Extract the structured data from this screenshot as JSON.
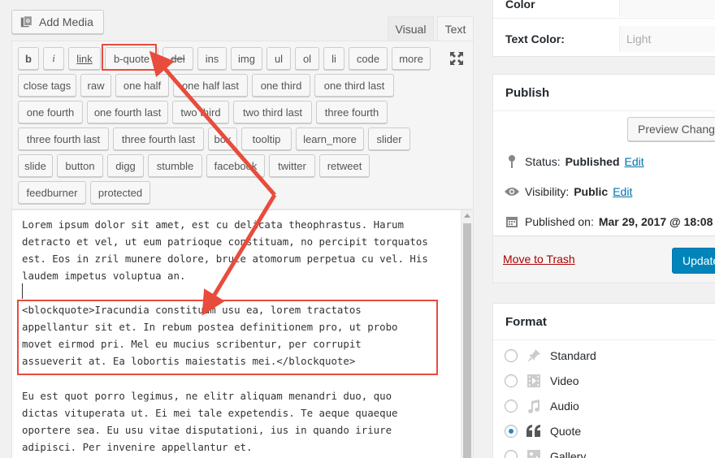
{
  "editor": {
    "add_media_label": "Add Media",
    "tabs": {
      "visual": "Visual",
      "text": "Text"
    },
    "quicktags": [
      [
        "b",
        "i",
        "link",
        "b-quote",
        "del",
        "ins",
        "img",
        "ul",
        "ol",
        "li",
        "code",
        "more"
      ],
      [
        "close tags",
        "raw",
        "one half",
        "one half last",
        "one third",
        "one third last"
      ],
      [
        "one fourth",
        "one fourth last",
        "two third",
        "two third last",
        "three fourth"
      ],
      [
        "three fourth last",
        "three fourth last",
        "box",
        "tooltip",
        "learn_more",
        "slider"
      ],
      [
        "slide",
        "button",
        "digg",
        "stumble",
        "facebook",
        "twitter",
        "retweet"
      ],
      [
        "feedburner",
        "protected"
      ]
    ],
    "content": {
      "p1": "Lorem ipsum dolor sit amet, est cu delicata theophrastus. Harum\ndetracto et vel, ut eum patrioque constituam, no percipit torquatos\nest. Eos in zril munere dolore, brute atomorum perpetua cu vel. His\nlaudem impetus voluptua an.",
      "p2": "<blockquote>Iracundia constituam usu ea, lorem tractatos\nappellantur sit et. In rebum postea definitionem pro, ut probo\nmovet eirmod pri. Mel eu mucius scribentur, per corrupit\nassueverit at. Ea lobortis maiestatis mei.</blockquote>",
      "p3": "Eu est quot porro legimus, ne elitr aliquam menandri duo, quo\ndictas vituperata ut. Ei mei tale expetendis. Te aeque quaeque\noportere sea. Eu usu vitae disputationi, ius in quando iriure\nadipisci. Per invenire appellantur et."
    }
  },
  "sidebar": {
    "color_rows": [
      {
        "label": "Color",
        "value": ""
      },
      {
        "label": "Text Color:",
        "value": "Light"
      }
    ],
    "publish": {
      "title": "Publish",
      "preview_label": "Preview Changes",
      "status_label": "Status:",
      "status_value": "Published",
      "visibility_label": "Visibility:",
      "visibility_value": "Public",
      "published_label": "Published on:",
      "published_value": "Mar 29, 2017 @ 18:08",
      "edit_label": "Edit",
      "trash_label": "Move to Trash",
      "update_label": "Update"
    },
    "format": {
      "title": "Format",
      "options": [
        {
          "label": "Standard",
          "icon": "pin-icon",
          "checked": false
        },
        {
          "label": "Video",
          "icon": "video-icon",
          "checked": false
        },
        {
          "label": "Audio",
          "icon": "audio-icon",
          "checked": false
        },
        {
          "label": "Quote",
          "icon": "quote-icon",
          "checked": true
        },
        {
          "label": "Gallery",
          "icon": "gallery-icon",
          "checked": false
        }
      ]
    }
  },
  "colors": {
    "annotation": "#e74c3c",
    "primary_button": "#0085ba",
    "link": "#0073aa",
    "trash": "#a00"
  }
}
